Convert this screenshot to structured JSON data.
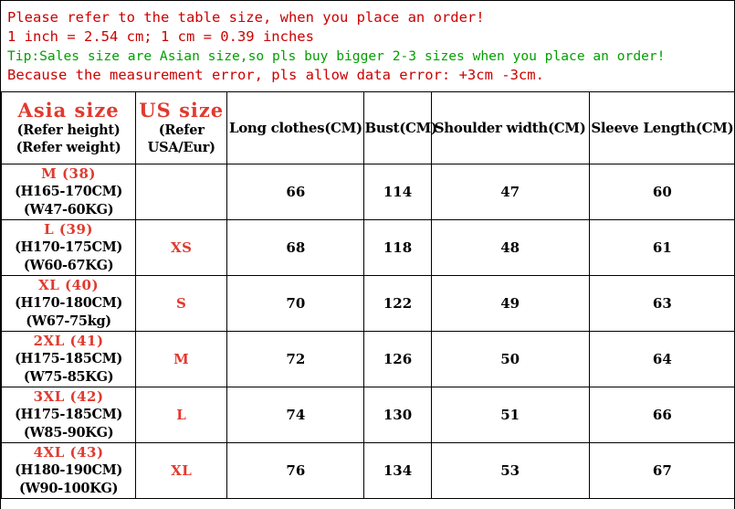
{
  "notice": {
    "lines": [
      {
        "text": "Please refer to the table size, when you place an order!",
        "color": "red"
      },
      {
        "text": "1 inch = 2.54 cm; 1 cm = 0.39 inches",
        "color": "red"
      },
      {
        "text": "Tip:Sales size are Asian size,so pls buy bigger 2-3 sizes when you place an order!",
        "color": "green"
      },
      {
        "text": "Because the measurement error, pls allow data error: +3cm -3cm.",
        "color": "red"
      }
    ]
  },
  "colors": {
    "red": "#cc0000",
    "heading_red": "#e03a2f",
    "green": "#00a000",
    "border": "#000000",
    "background": "#ffffff"
  },
  "table": {
    "header": {
      "asia_title": "Asia size",
      "asia_sub1": "(Refer height)",
      "asia_sub2": "(Refer weight)",
      "us_title": "US size",
      "us_sub1": "(Refer",
      "us_sub2": "USA/Eur)",
      "long_clothes": "Long clothes(CM)",
      "bust": "Bust(CM)",
      "shoulder": "Shoulder width(CM)",
      "sleeve": "Sleeve Length(CM)"
    },
    "rows": [
      {
        "asia_size": "M (38)",
        "height": "(H165-170CM)",
        "weight": "(W47-60KG)",
        "us_size": "",
        "long_clothes": "66",
        "bust": "114",
        "shoulder": "47",
        "sleeve": "60"
      },
      {
        "asia_size": "L (39)",
        "height": "(H170-175CM)",
        "weight": "(W60-67KG)",
        "us_size": "XS",
        "long_clothes": "68",
        "bust": "118",
        "shoulder": "48",
        "sleeve": "61"
      },
      {
        "asia_size": "XL (40)",
        "height": "(H170-180CM)",
        "weight": "(W67-75kg)",
        "us_size": "S",
        "long_clothes": "70",
        "bust": "122",
        "shoulder": "49",
        "sleeve": "63"
      },
      {
        "asia_size": "2XL (41)",
        "height": "(H175-185CM)",
        "weight": "(W75-85KG)",
        "us_size": "M",
        "long_clothes": "72",
        "bust": "126",
        "shoulder": "50",
        "sleeve": "64"
      },
      {
        "asia_size": "3XL (42)",
        "height": "(H175-185CM)",
        "weight": "(W85-90KG)",
        "us_size": "L",
        "long_clothes": "74",
        "bust": "130",
        "shoulder": "51",
        "sleeve": "66"
      },
      {
        "asia_size": "4XL (43)",
        "height": "(H180-190CM)",
        "weight": "(W90-100KG)",
        "us_size": "XL",
        "long_clothes": "76",
        "bust": "134",
        "shoulder": "53",
        "sleeve": "67"
      }
    ]
  }
}
